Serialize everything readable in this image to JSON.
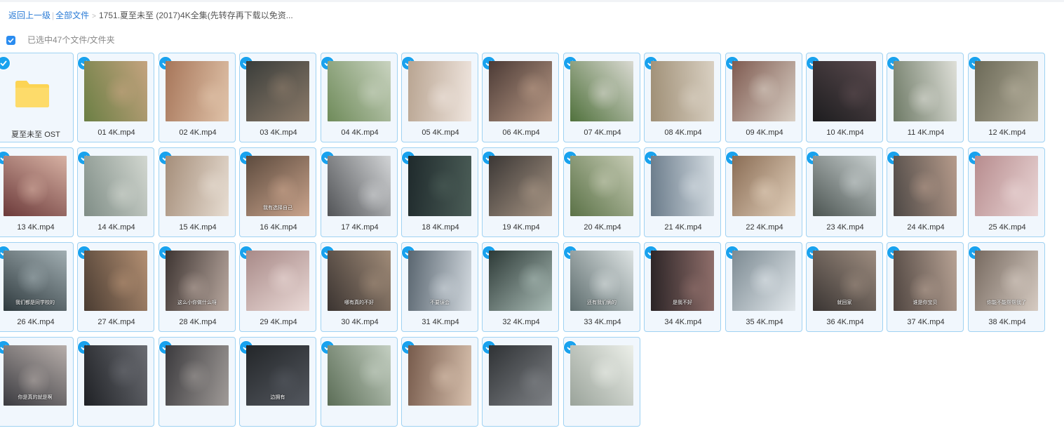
{
  "breadcrumb": {
    "back": "返回上一级",
    "all_files": "全部文件",
    "current": "1751.夏至未至 (2017)4K全集(先转存再下载以免资..."
  },
  "selection": {
    "text": "已选中47个文件/文件夹"
  },
  "colors": {
    "accent": "#2a8cf0",
    "check": "#19a2ee",
    "tile_border": "#9fd2f2",
    "tile_bg": "#f1f7fd",
    "folder": "#fcd454"
  },
  "items": [
    {
      "name": "夏至未至 OST",
      "type": "folder",
      "icon": "folder-icon"
    },
    {
      "name": "01 4K.mp4",
      "type": "video",
      "caption": ""
    },
    {
      "name": "02 4K.mp4",
      "type": "video",
      "caption": ""
    },
    {
      "name": "03 4K.mp4",
      "type": "video",
      "caption": ""
    },
    {
      "name": "04 4K.mp4",
      "type": "video",
      "caption": ""
    },
    {
      "name": "05 4K.mp4",
      "type": "video",
      "caption": ""
    },
    {
      "name": "06 4K.mp4",
      "type": "video",
      "caption": ""
    },
    {
      "name": "07 4K.mp4",
      "type": "video",
      "caption": ""
    },
    {
      "name": "08 4K.mp4",
      "type": "video",
      "caption": ""
    },
    {
      "name": "09 4K.mp4",
      "type": "video",
      "caption": ""
    },
    {
      "name": "10 4K.mp4",
      "type": "video",
      "caption": ""
    },
    {
      "name": "11 4K.mp4",
      "type": "video",
      "caption": ""
    },
    {
      "name": "12 4K.mp4",
      "type": "video",
      "caption": ""
    },
    {
      "name": "13 4K.mp4",
      "type": "video",
      "caption": ""
    },
    {
      "name": "14 4K.mp4",
      "type": "video",
      "caption": ""
    },
    {
      "name": "15 4K.mp4",
      "type": "video",
      "caption": ""
    },
    {
      "name": "16 4K.mp4",
      "type": "video",
      "caption": "我有选择自己"
    },
    {
      "name": "17 4K.mp4",
      "type": "video",
      "caption": ""
    },
    {
      "name": "18 4K.mp4",
      "type": "video",
      "caption": ""
    },
    {
      "name": "19 4K.mp4",
      "type": "video",
      "caption": ""
    },
    {
      "name": "20 4K.mp4",
      "type": "video",
      "caption": ""
    },
    {
      "name": "21 4K.mp4",
      "type": "video",
      "caption": ""
    },
    {
      "name": "22 4K.mp4",
      "type": "video",
      "caption": ""
    },
    {
      "name": "23 4K.mp4",
      "type": "video",
      "caption": ""
    },
    {
      "name": "24 4K.mp4",
      "type": "video",
      "caption": ""
    },
    {
      "name": "25 4K.mp4",
      "type": "video",
      "caption": ""
    },
    {
      "name": "26 4K.mp4",
      "type": "video",
      "caption": "我们都是同学校的"
    },
    {
      "name": "27 4K.mp4",
      "type": "video",
      "caption": ""
    },
    {
      "name": "28 4K.mp4",
      "type": "video",
      "caption": "这么小你做什么呀"
    },
    {
      "name": "29 4K.mp4",
      "type": "video",
      "caption": ""
    },
    {
      "name": "30 4K.mp4",
      "type": "video",
      "caption": "哪有真的不好"
    },
    {
      "name": "31 4K.mp4",
      "type": "video",
      "caption": "不要误会"
    },
    {
      "name": "32 4K.mp4",
      "type": "video",
      "caption": ""
    },
    {
      "name": "33 4K.mp4",
      "type": "video",
      "caption": "还有我们俩的"
    },
    {
      "name": "34 4K.mp4",
      "type": "video",
      "caption": "是我不好"
    },
    {
      "name": "35 4K.mp4",
      "type": "video",
      "caption": ""
    },
    {
      "name": "36 4K.mp4",
      "type": "video",
      "caption": "就回家"
    },
    {
      "name": "37 4K.mp4",
      "type": "video",
      "caption": "谁是你宝贝"
    },
    {
      "name": "38 4K.mp4",
      "type": "video",
      "caption": "你能不能帮帮我了"
    },
    {
      "name": "",
      "type": "video",
      "caption": "你是真的就是啊"
    },
    {
      "name": "",
      "type": "video",
      "caption": ""
    },
    {
      "name": "",
      "type": "video",
      "caption": ""
    },
    {
      "name": "",
      "type": "video",
      "caption": "边拥有"
    },
    {
      "name": "",
      "type": "video",
      "caption": ""
    },
    {
      "name": "",
      "type": "video",
      "caption": ""
    },
    {
      "name": "",
      "type": "video",
      "caption": ""
    },
    {
      "name": "",
      "type": "video",
      "caption": ""
    }
  ]
}
